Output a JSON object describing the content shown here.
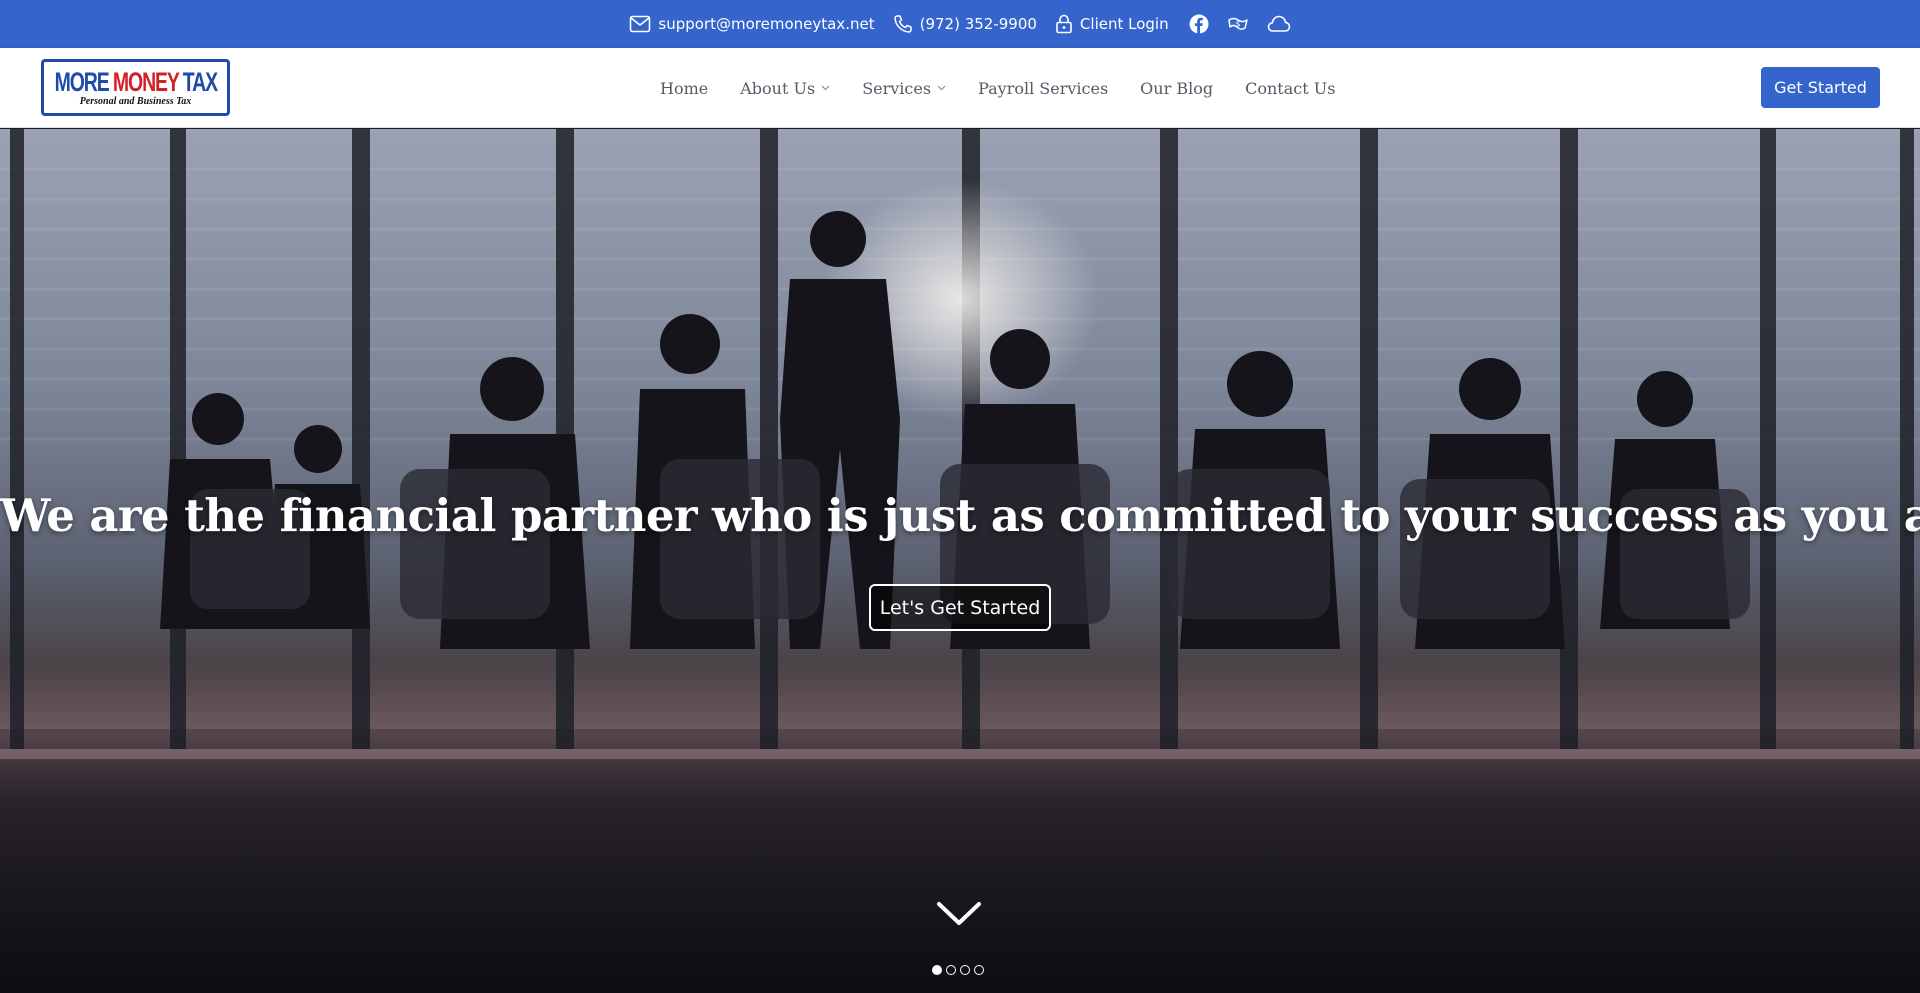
{
  "topbar": {
    "email": "support@moremoneytax.net",
    "phone": "(972) 352-9900",
    "client_login": "Client Login",
    "social_icons": [
      "facebook-icon",
      "dollar-hand-icon",
      "cloud-icon"
    ]
  },
  "logo": {
    "line1_blue_a": "MORE ",
    "line1_red": "MONEY",
    "line1_blue_b": " TAX",
    "line2": "Personal and Business Tax"
  },
  "nav": {
    "items": [
      {
        "label": "Home",
        "dropdown": false
      },
      {
        "label": "About Us",
        "dropdown": true
      },
      {
        "label": "Services",
        "dropdown": true
      },
      {
        "label": "Payroll Services",
        "dropdown": false
      },
      {
        "label": "Our Blog",
        "dropdown": false
      },
      {
        "label": "Contact Us",
        "dropdown": false
      }
    ],
    "cta_label": "Get Started"
  },
  "hero": {
    "headline": "We are the financial partner who is just as committed to your success as you are.",
    "button_label": "Let's Get Started",
    "slide_count": 4,
    "active_slide": 1
  },
  "colors": {
    "brand_blue": "#3464cc",
    "logo_blue": "#1f4aa8",
    "logo_red": "#d31f26",
    "nav_text": "#555a64"
  }
}
